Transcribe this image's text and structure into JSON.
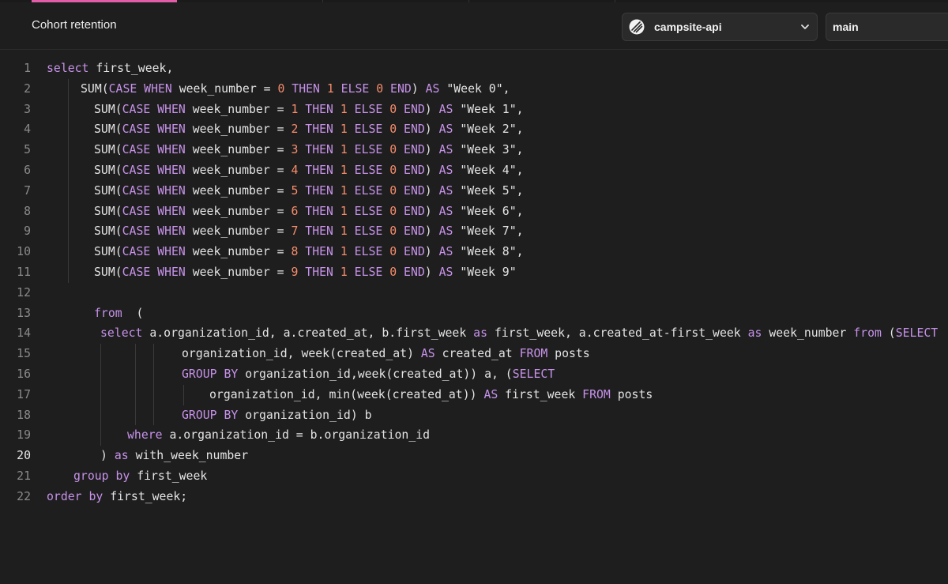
{
  "header": {
    "title": "Cohort retention",
    "database_select": {
      "value": "campsite-api",
      "icon": "database-icon"
    },
    "branch_select": {
      "value": "main"
    },
    "colors": {
      "active_tab_indicator": "#e35ca8",
      "keyword": "#c792ea",
      "number": "#f78c6c"
    }
  },
  "editor": {
    "active_line": 20,
    "lines": [
      {
        "n": "1",
        "indent": 0,
        "tokens": [
          [
            "kw",
            "select"
          ],
          [
            "id",
            " first_week,"
          ]
        ]
      },
      {
        "n": "2",
        "indent": 0,
        "pad": 43,
        "tokens": [
          [
            "id",
            "SUM("
          ],
          [
            "kw",
            "CASE WHEN"
          ],
          [
            "id",
            " week_number = "
          ],
          [
            "num",
            "0"
          ],
          [
            "kw",
            " THEN "
          ],
          [
            "num",
            "1"
          ],
          [
            "kw",
            " ELSE "
          ],
          [
            "num",
            "0"
          ],
          [
            "kw",
            " END"
          ],
          [
            "id",
            ") "
          ],
          [
            "kw",
            "AS"
          ],
          [
            "str",
            " \"Week 0\","
          ]
        ]
      },
      {
        "n": "3",
        "indent": 0,
        "pad": 60,
        "tokens": [
          [
            "id",
            "SUM("
          ],
          [
            "kw",
            "CASE WHEN"
          ],
          [
            "id",
            " week_number = "
          ],
          [
            "num",
            "1"
          ],
          [
            "kw",
            " THEN "
          ],
          [
            "num",
            "1"
          ],
          [
            "kw",
            " ELSE "
          ],
          [
            "num",
            "0"
          ],
          [
            "kw",
            " END"
          ],
          [
            "id",
            ") "
          ],
          [
            "kw",
            "AS"
          ],
          [
            "str",
            " \"Week 1\","
          ]
        ]
      },
      {
        "n": "4",
        "indent": 0,
        "pad": 60,
        "tokens": [
          [
            "id",
            "SUM("
          ],
          [
            "kw",
            "CASE WHEN"
          ],
          [
            "id",
            " week_number = "
          ],
          [
            "num",
            "2"
          ],
          [
            "kw",
            " THEN "
          ],
          [
            "num",
            "1"
          ],
          [
            "kw",
            " ELSE "
          ],
          [
            "num",
            "0"
          ],
          [
            "kw",
            " END"
          ],
          [
            "id",
            ") "
          ],
          [
            "kw",
            "AS"
          ],
          [
            "str",
            " \"Week 2\","
          ]
        ]
      },
      {
        "n": "5",
        "indent": 0,
        "pad": 60,
        "tokens": [
          [
            "id",
            "SUM("
          ],
          [
            "kw",
            "CASE WHEN"
          ],
          [
            "id",
            " week_number = "
          ],
          [
            "num",
            "3"
          ],
          [
            "kw",
            " THEN "
          ],
          [
            "num",
            "1"
          ],
          [
            "kw",
            " ELSE "
          ],
          [
            "num",
            "0"
          ],
          [
            "kw",
            " END"
          ],
          [
            "id",
            ") "
          ],
          [
            "kw",
            "AS"
          ],
          [
            "str",
            " \"Week 3\","
          ]
        ]
      },
      {
        "n": "6",
        "indent": 0,
        "pad": 60,
        "tokens": [
          [
            "id",
            "SUM("
          ],
          [
            "kw",
            "CASE WHEN"
          ],
          [
            "id",
            " week_number = "
          ],
          [
            "num",
            "4"
          ],
          [
            "kw",
            " THEN "
          ],
          [
            "num",
            "1"
          ],
          [
            "kw",
            " ELSE "
          ],
          [
            "num",
            "0"
          ],
          [
            "kw",
            " END"
          ],
          [
            "id",
            ") "
          ],
          [
            "kw",
            "AS"
          ],
          [
            "str",
            " \"Week 4\","
          ]
        ]
      },
      {
        "n": "7",
        "indent": 0,
        "pad": 60,
        "tokens": [
          [
            "id",
            "SUM("
          ],
          [
            "kw",
            "CASE WHEN"
          ],
          [
            "id",
            " week_number = "
          ],
          [
            "num",
            "5"
          ],
          [
            "kw",
            " THEN "
          ],
          [
            "num",
            "1"
          ],
          [
            "kw",
            " ELSE "
          ],
          [
            "num",
            "0"
          ],
          [
            "kw",
            " END"
          ],
          [
            "id",
            ") "
          ],
          [
            "kw",
            "AS"
          ],
          [
            "str",
            " \"Week 5\","
          ]
        ]
      },
      {
        "n": "8",
        "indent": 0,
        "pad": 60,
        "tokens": [
          [
            "id",
            "SUM("
          ],
          [
            "kw",
            "CASE WHEN"
          ],
          [
            "id",
            " week_number = "
          ],
          [
            "num",
            "6"
          ],
          [
            "kw",
            " THEN "
          ],
          [
            "num",
            "1"
          ],
          [
            "kw",
            " ELSE "
          ],
          [
            "num",
            "0"
          ],
          [
            "kw",
            " END"
          ],
          [
            "id",
            ") "
          ],
          [
            "kw",
            "AS"
          ],
          [
            "str",
            " \"Week 6\","
          ]
        ]
      },
      {
        "n": "9",
        "indent": 0,
        "pad": 60,
        "tokens": [
          [
            "id",
            "SUM("
          ],
          [
            "kw",
            "CASE WHEN"
          ],
          [
            "id",
            " week_number = "
          ],
          [
            "num",
            "7"
          ],
          [
            "kw",
            " THEN "
          ],
          [
            "num",
            "1"
          ],
          [
            "kw",
            " ELSE "
          ],
          [
            "num",
            "0"
          ],
          [
            "kw",
            " END"
          ],
          [
            "id",
            ") "
          ],
          [
            "kw",
            "AS"
          ],
          [
            "str",
            " \"Week 7\","
          ]
        ]
      },
      {
        "n": "10",
        "indent": 0,
        "pad": 60,
        "tokens": [
          [
            "id",
            "SUM("
          ],
          [
            "kw",
            "CASE WHEN"
          ],
          [
            "id",
            " week_number = "
          ],
          [
            "num",
            "8"
          ],
          [
            "kw",
            " THEN "
          ],
          [
            "num",
            "1"
          ],
          [
            "kw",
            " ELSE "
          ],
          [
            "num",
            "0"
          ],
          [
            "kw",
            " END"
          ],
          [
            "id",
            ") "
          ],
          [
            "kw",
            "AS"
          ],
          [
            "str",
            " \"Week 8\","
          ]
        ]
      },
      {
        "n": "11",
        "indent": 0,
        "pad": 60,
        "tokens": [
          [
            "id",
            "SUM("
          ],
          [
            "kw",
            "CASE WHEN"
          ],
          [
            "id",
            " week_number = "
          ],
          [
            "num",
            "9"
          ],
          [
            "kw",
            " THEN "
          ],
          [
            "num",
            "1"
          ],
          [
            "kw",
            " ELSE "
          ],
          [
            "num",
            "0"
          ],
          [
            "kw",
            " END"
          ],
          [
            "id",
            ") "
          ],
          [
            "kw",
            "AS"
          ],
          [
            "str",
            " \"Week 9\""
          ]
        ]
      },
      {
        "n": "12",
        "indent": 0,
        "tokens": []
      },
      {
        "n": "13",
        "indent": 0,
        "pad": 60,
        "tokens": [
          [
            "kw",
            "from"
          ],
          [
            "id",
            "  ("
          ]
        ]
      },
      {
        "n": "14",
        "indent": 0,
        "pad": 68,
        "tokens": [
          [
            "kw",
            "select"
          ],
          [
            "id",
            " a.organization_id, a.created_at, b.first_week "
          ],
          [
            "kw",
            "as"
          ],
          [
            "id",
            " first_week, a.created_at-first_week "
          ],
          [
            "kw",
            "as"
          ],
          [
            "id",
            " week_number "
          ],
          [
            "kw",
            "from"
          ],
          [
            "id",
            " ("
          ],
          [
            "kw",
            "SELECT"
          ]
        ]
      },
      {
        "n": "15",
        "indent": 0,
        "pad": 171,
        "tokens": [
          [
            "id",
            "organization_id, week(created_at) "
          ],
          [
            "kw",
            "AS"
          ],
          [
            "id",
            " created_at "
          ],
          [
            "kw",
            "FROM"
          ],
          [
            "id",
            " posts"
          ]
        ]
      },
      {
        "n": "16",
        "indent": 0,
        "pad": 171,
        "tokens": [
          [
            "kw",
            "GROUP BY"
          ],
          [
            "id",
            " organization_id,week(created_at)) a, ("
          ],
          [
            "kw",
            "SELECT"
          ]
        ]
      },
      {
        "n": "17",
        "indent": 0,
        "pad": 206,
        "tokens": [
          [
            "id",
            "organization_id, min(week(created_at)) "
          ],
          [
            "kw",
            "AS"
          ],
          [
            "id",
            " first_week "
          ],
          [
            "kw",
            "FROM"
          ],
          [
            "id",
            " posts"
          ]
        ]
      },
      {
        "n": "18",
        "indent": 0,
        "pad": 171,
        "tokens": [
          [
            "kw",
            "GROUP BY"
          ],
          [
            "id",
            " organization_id) b"
          ]
        ]
      },
      {
        "n": "19",
        "indent": 0,
        "pad": 102,
        "tokens": [
          [
            "kw",
            "where"
          ],
          [
            "id",
            " a.organization_id = b.organization_id"
          ]
        ]
      },
      {
        "n": "20",
        "indent": 0,
        "pad": 68,
        "tokens": [
          [
            "id",
            ") "
          ],
          [
            "kw",
            "as"
          ],
          [
            "id",
            " with_week_number"
          ]
        ]
      },
      {
        "n": "21",
        "indent": 0,
        "pad": 34,
        "tokens": [
          [
            "kw",
            "group by"
          ],
          [
            "id",
            " first_week"
          ]
        ]
      },
      {
        "n": "22",
        "indent": 0,
        "pad": 0,
        "tokens": [
          [
            "kw",
            "order by"
          ],
          [
            "id",
            " first_week;"
          ]
        ]
      }
    ]
  }
}
